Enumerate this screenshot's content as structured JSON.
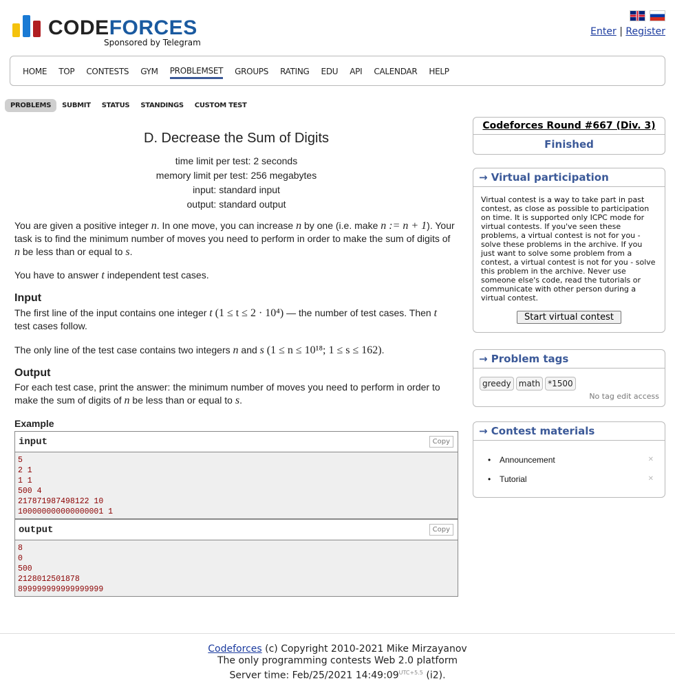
{
  "brand": {
    "name_part1": "Code",
    "name_part2": "forces",
    "sponsor": "Sponsored by Telegram"
  },
  "auth": {
    "enter": "Enter",
    "separator": "|",
    "register": "Register"
  },
  "menu": {
    "items": [
      "HOME",
      "TOP",
      "CONTESTS",
      "GYM",
      "PROBLEMSET",
      "GROUPS",
      "RATING",
      "EDU",
      "API",
      "CALENDAR",
      "HELP"
    ],
    "active": "PROBLEMSET"
  },
  "submenu": {
    "items": [
      "PROBLEMS",
      "SUBMIT",
      "STATUS",
      "STANDINGS",
      "CUSTOM TEST"
    ],
    "active": "PROBLEMS"
  },
  "problem": {
    "title": "D. Decrease the Sum of Digits",
    "time_limit": "time limit per test: 2 seconds",
    "memory_limit": "memory limit per test: 256 megabytes",
    "input": "input: standard input",
    "output": "output: standard output",
    "p1_a": "You are given a positive integer ",
    "p1_b": ". In one move, you can increase ",
    "p1_c": " by one (i.e. make ",
    "p1_d": "). Your task is to find the minimum number of moves you need to perform in order to make the sum of digits of ",
    "p1_e": " be less than or equal to ",
    "p1_f": ".",
    "p2_a": "You have to answer ",
    "p2_b": " independent test cases.",
    "input_title": "Input",
    "in1_a": "The first line of the input contains one integer ",
    "in1_b": " — the number of test cases. Then ",
    "in1_c": " test cases follow.",
    "in2_a": "The only line of the test case contains two integers ",
    "in2_b": " and ",
    "in2_c": ".",
    "output_title": "Output",
    "out1_a": "For each test case, print the answer: the minimum number of moves you need to perform in order to make the sum of digits of ",
    "out1_b": " be less than or equal to ",
    "out1_c": ".",
    "example_title": "Example",
    "var_n": "n",
    "var_s": "s",
    "var_t": "t",
    "formula_move": "n := n + 1",
    "formula_t": "(1 ≤ t ≤ 2 · 10⁴)",
    "formula_ns": "(1 ≤ n ≤ 10¹⁸; 1 ≤ s ≤ 162)"
  },
  "sample": {
    "input_label": "input",
    "output_label": "output",
    "copy": "Copy",
    "input_text": "5\n2 1\n1 1\n500 4\n217871987498122 10\n100000000000000001 1",
    "output_text": "8\n0\n500\n2128012501878\n899999999999999999"
  },
  "sidebar": {
    "contest_name": "Codeforces Round #667 (Div. 3)",
    "contest_status": "Finished",
    "vp_title": "→ Virtual participation",
    "vp_text": "Virtual contest is a way to take part in past contest, as close as possible to participation on time. It is supported only ICPC mode for virtual contests. If you've seen these problems, a virtual contest is not for you - solve these problems in the archive. If you just want to solve some problem from a contest, a virtual contest is not for you - solve this problem in the archive. Never use someone else's code, read the tutorials or communicate with other person during a virtual contest.",
    "vp_button": "Start virtual contest",
    "tags_title": "→ Problem tags",
    "tags": [
      "greedy",
      "math",
      "*1500"
    ],
    "tags_note": "No tag edit access",
    "materials_title": "→ Contest materials",
    "materials": [
      "Announcement",
      "Tutorial"
    ]
  },
  "footer": {
    "link": "Codeforces",
    "copyright": " (c) Copyright 2010-2021 Mike Mirzayanov",
    "line2": "The only programming contests Web 2.0 platform",
    "server_time": "Server time: Feb/25/2021 14:49:09",
    "utc": "UTC+5.5",
    "server_suffix": " (i2)."
  },
  "colors": {
    "accent": "#3b5998",
    "bar_yellow": "#f4c20d",
    "bar_blue": "#1a7ad4",
    "bar_red": "#b11e22"
  }
}
